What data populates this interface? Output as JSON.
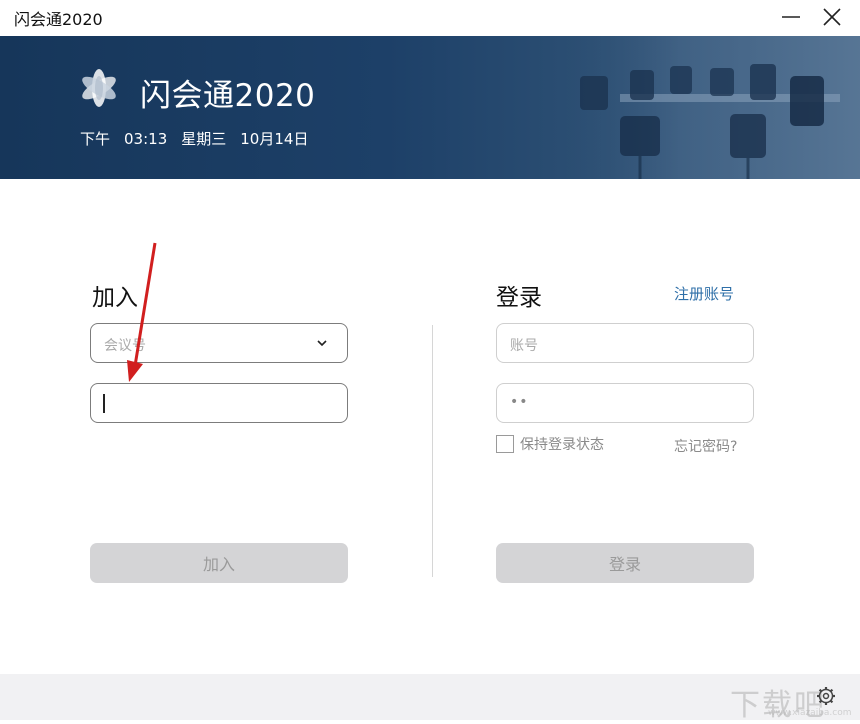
{
  "window": {
    "title": "闪会通2020"
  },
  "banner": {
    "app_name": "闪会通2020",
    "ampm": "下午",
    "time": "03:13",
    "weekday": "星期三",
    "date": "10月14日"
  },
  "join": {
    "title": "加入",
    "meeting_placeholder": "会议号",
    "button": "加入"
  },
  "login": {
    "title": "登录",
    "register_link": "注册账号",
    "account_placeholder": "账号",
    "password_dots": "••",
    "remember_label": "保持登录状态",
    "forgot_link": "忘记密码?",
    "button": "登录"
  },
  "watermark": {
    "big": "下载吧",
    "small": "www.xiazaiba.com"
  },
  "colors": {
    "banner": "#1d4068",
    "link": "#2e6fa8",
    "disabled_button": "#d4d4d6",
    "arrow": "#d11f1f"
  },
  "icons": [
    "minimize-icon",
    "close-icon",
    "app-logo-icon",
    "chevron-down-icon",
    "gear-icon"
  ]
}
